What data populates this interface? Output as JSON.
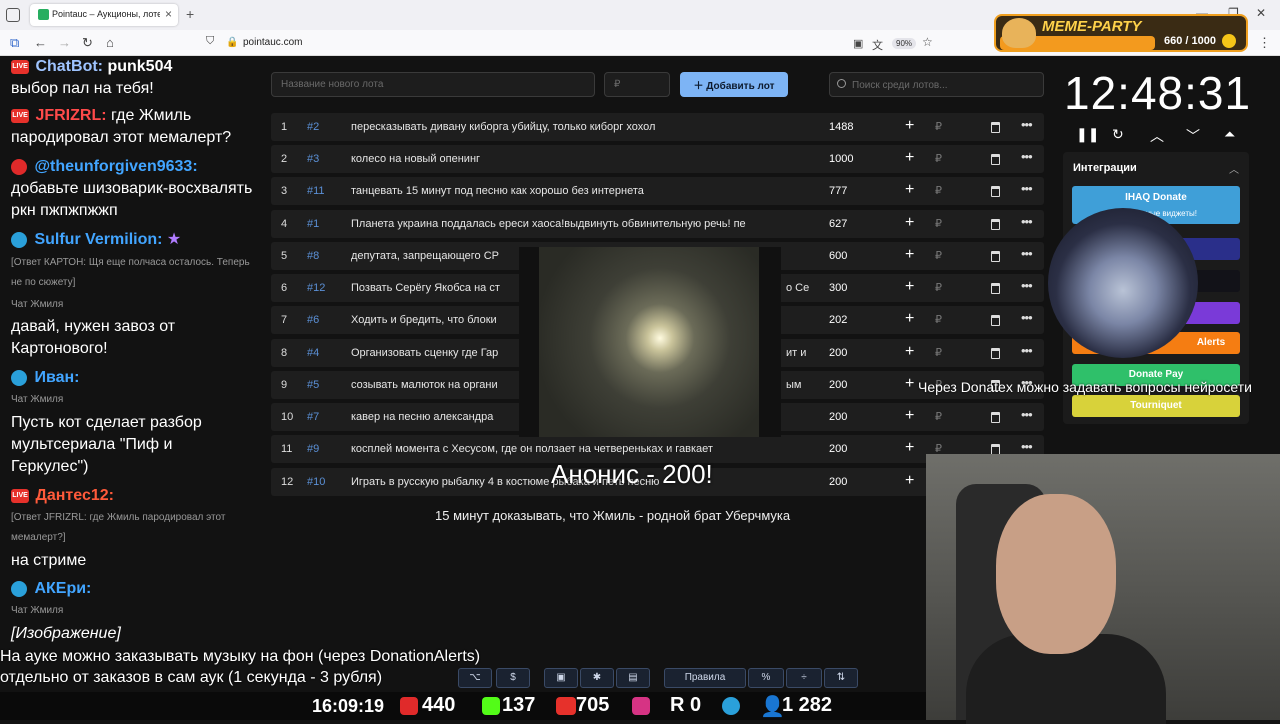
{
  "browser": {
    "tab_title": "Pointauc – Аукционы, лотереи",
    "url": "pointauc.com",
    "zoom": "90%"
  },
  "meme_party": {
    "title": "MEME-PARTY",
    "count": "660 / 1000"
  },
  "chat": [
    {
      "nick": "ChatBot:",
      "extra": " punk504",
      "text": "выбор пал на тебя!"
    },
    {
      "nick": "JFRIZRL:",
      "text": "где Жмиль пародировал этот мемалерт?"
    },
    {
      "nick": "@theunforgiven9633:",
      "text": "добавьте шизоварик-восхвалять ркн пжпжпжжп"
    },
    {
      "nick": "Sulfur Vermilion:",
      "reply": "[Ответ КАРТОН: Щя еще полчаса осталось. Теперь не по сюжету]",
      "source": "Чат Жмиля",
      "text": "давай, нужен завоз от Картонового!"
    },
    {
      "nick": "Иван:",
      "source": "Чат Жмиля",
      "text": "Пусть кот сделает разбор мультсериала \"Пиф и Геркулес\")"
    },
    {
      "nick": "Дантес12:",
      "reply": "[Ответ JFRIZRL: где Жмиль пародировал этот мемалерт?]",
      "text": "на стриме"
    },
    {
      "nick": "АКЕри:",
      "source": "Чат Жмиля",
      "text": "[Изображение]"
    }
  ],
  "auction": {
    "new_lot_placeholder": "Название нового лота",
    "price_placeholder": "₽",
    "add_button": "Добавить лот",
    "search_placeholder": "Поиск среди лотов...",
    "currency": "₽",
    "lots": [
      {
        "n": "1",
        "id": "#2",
        "name": "пересказывать дивану киборга убийцу, только киборг хохол",
        "sum": "1488"
      },
      {
        "n": "2",
        "id": "#3",
        "name": "колесо на новый опенинг",
        "sum": "1000"
      },
      {
        "n": "3",
        "id": "#11",
        "name": "танцевать 15 минут под песню как хорошо без интернета",
        "sum": "777"
      },
      {
        "n": "4",
        "id": "#1",
        "name": "Планета украина поддалась ереси хаоса!выдвинуть обвинительную речь! пе",
        "sum": "627"
      },
      {
        "n": "5",
        "id": "#8",
        "name": "депутата, запрещающего СР",
        "sum": "600"
      },
      {
        "n": "6",
        "id": "#12",
        "name": "Позвать Серёгу Якобса на ст",
        "tail": "о Се",
        "sum": "300"
      },
      {
        "n": "7",
        "id": "#6",
        "name": "Ходить и бредить, что блоки",
        "sum": "202"
      },
      {
        "n": "8",
        "id": "#4",
        "name": "Организовать сценку где Гар",
        "tail": "ит и",
        "sum": "200"
      },
      {
        "n": "9",
        "id": "#5",
        "name": "созывать малюток на органи",
        "tail": "ым",
        "sum": "200"
      },
      {
        "n": "10",
        "id": "#7",
        "name": "кавер на песню александра",
        "sum": "200"
      },
      {
        "n": "11",
        "id": "#9",
        "name": "косплей момента с Хесусом, где он ползает на четвереньках и гавкает",
        "sum": "200"
      },
      {
        "n": "12",
        "id": "#10",
        "name": "Играть в русскую рыбалку 4 в костюме рыбака и петь песню",
        "sum": "200"
      }
    ]
  },
  "announcement": "Анонис - 200!",
  "caption": "15 минут доказывать, что Жмиль - родной брат Уберчмука",
  "timer": "12:48:31",
  "integrations": {
    "title": "Интеграции",
    "ihaq": "IHAQ Donate",
    "ihaq_sub": "Уникальные виджеты!",
    "alerts": "Alerts",
    "donatepay": "Donate Pay",
    "tourniquet": "Tourniquet"
  },
  "overlay_text": "Через Donatex можно задавать вопросы нейросети",
  "bottom_msg": {
    "line1": "На ауке можно заказывать музыку на фон (через DonationAlerts)",
    "line2": "отдельно от заказов в сам аук (1 секунда - 3 рубля)"
  },
  "toolbar": {
    "rules": "Правила"
  },
  "status": {
    "time": "16:09:19",
    "youtube": "440",
    "kick": "137",
    "vk": "705",
    "r": "0",
    "total": "1 282"
  },
  "colors": {
    "accent": "#7db4f5",
    "lot_id": "#5b90d6"
  }
}
